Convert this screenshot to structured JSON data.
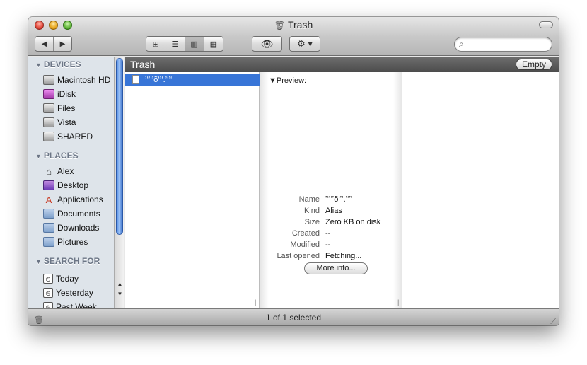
{
  "window": {
    "title": "Trash",
    "title_icon": "trash-icon"
  },
  "toolbar": {
    "back": "◀",
    "forward": "▶",
    "views": [
      "icon-view",
      "list-view",
      "column-view",
      "coverflow-view"
    ],
    "active_view": "column-view",
    "quicklook_icon": "eye-icon",
    "action_icon": "gear-icon",
    "search_placeholder": ""
  },
  "sidebar": {
    "devices_header": "DEVICES",
    "devices": [
      {
        "label": "Macintosh HD",
        "icon": "drive-icon"
      },
      {
        "label": "iDisk",
        "icon": "idisk-icon"
      },
      {
        "label": "Files",
        "icon": "drive-icon"
      },
      {
        "label": "Vista",
        "icon": "drive-icon"
      },
      {
        "label": "SHARED",
        "icon": "drive-icon"
      }
    ],
    "places_header": "PLACES",
    "places": [
      {
        "label": "Alex",
        "icon": "home-icon"
      },
      {
        "label": "Desktop",
        "icon": "desktop-icon"
      },
      {
        "label": "Applications",
        "icon": "applications-icon"
      },
      {
        "label": "Documents",
        "icon": "folder-icon"
      },
      {
        "label": "Downloads",
        "icon": "folder-icon"
      },
      {
        "label": "Pictures",
        "icon": "folder-icon"
      }
    ],
    "search_header": "SEARCH FOR",
    "searches": [
      {
        "label": "Today",
        "icon": "clock-icon"
      },
      {
        "label": "Yesterday",
        "icon": "clock-icon"
      },
      {
        "label": "Past Week",
        "icon": "clock-icon"
      }
    ]
  },
  "pathbar": {
    "title": "Trash",
    "empty_label": "Empty"
  },
  "file_column": {
    "selected_file": "ʼʻʼʻʼõʻʼʻ.ʼʻʼʻ"
  },
  "preview": {
    "label": "Preview:",
    "fields": [
      {
        "key": "Name",
        "value": "ʼʻʼʻʼõʻʼʻ.ʼʻʼʻ"
      },
      {
        "key": "Kind",
        "value": "Alias"
      },
      {
        "key": "Size",
        "value": "Zero KB on disk"
      },
      {
        "key": "Created",
        "value": "--"
      },
      {
        "key": "Modified",
        "value": "--"
      },
      {
        "key": "Last opened",
        "value": "Fetching..."
      }
    ],
    "more_info": "More info..."
  },
  "status": {
    "text": "1 of 1 selected"
  },
  "colors": {
    "selection": "#3875d7",
    "pathbar": "#5a5a5a",
    "sidebar": "#dee4ea"
  }
}
